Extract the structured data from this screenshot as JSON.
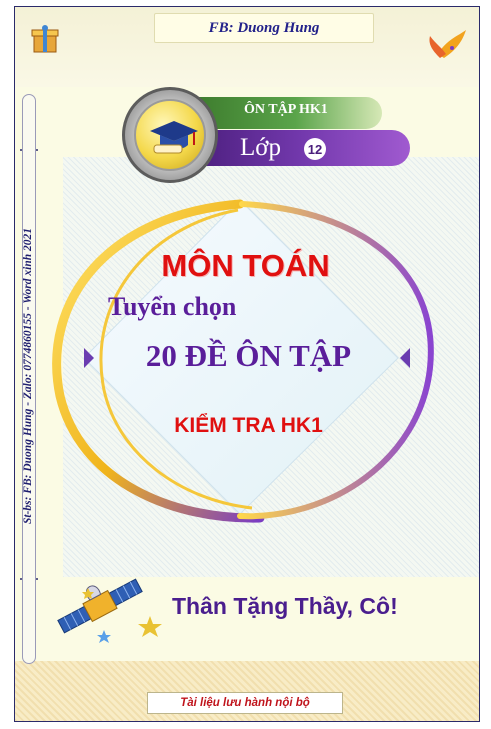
{
  "header": {
    "text": "FB: Duong Hung"
  },
  "side_text": "St-bs:  FB: Duong Hung  -  Zalo: 0774860155  -  Word xinh 2021",
  "badge": {
    "label": "ÔN TẬP HK1",
    "grade_prefix": "Lớp",
    "grade_number": "12"
  },
  "main": {
    "subject": "MÔN TOÁN",
    "subtitle": "Tuyển chọn",
    "count_title": "20 ĐỀ ÔN TẬP",
    "exam": "KIỂM TRA HK1"
  },
  "dedication": "Thân Tặng Thầy, Cô!",
  "footer": {
    "text": "Tài liệu lưu hành nội bộ"
  },
  "colors": {
    "title_red": "#e01010",
    "title_purple": "#5a1e9a",
    "frame": "#2a2a6a",
    "ribbon_green": "#3c7a2c",
    "ribbon_purple": "#4a1e7c"
  },
  "icons": [
    "gift-icon",
    "flame-bird-icon",
    "gear-icon",
    "graduation-cap-icon",
    "satellite-icon",
    "star-icon"
  ]
}
